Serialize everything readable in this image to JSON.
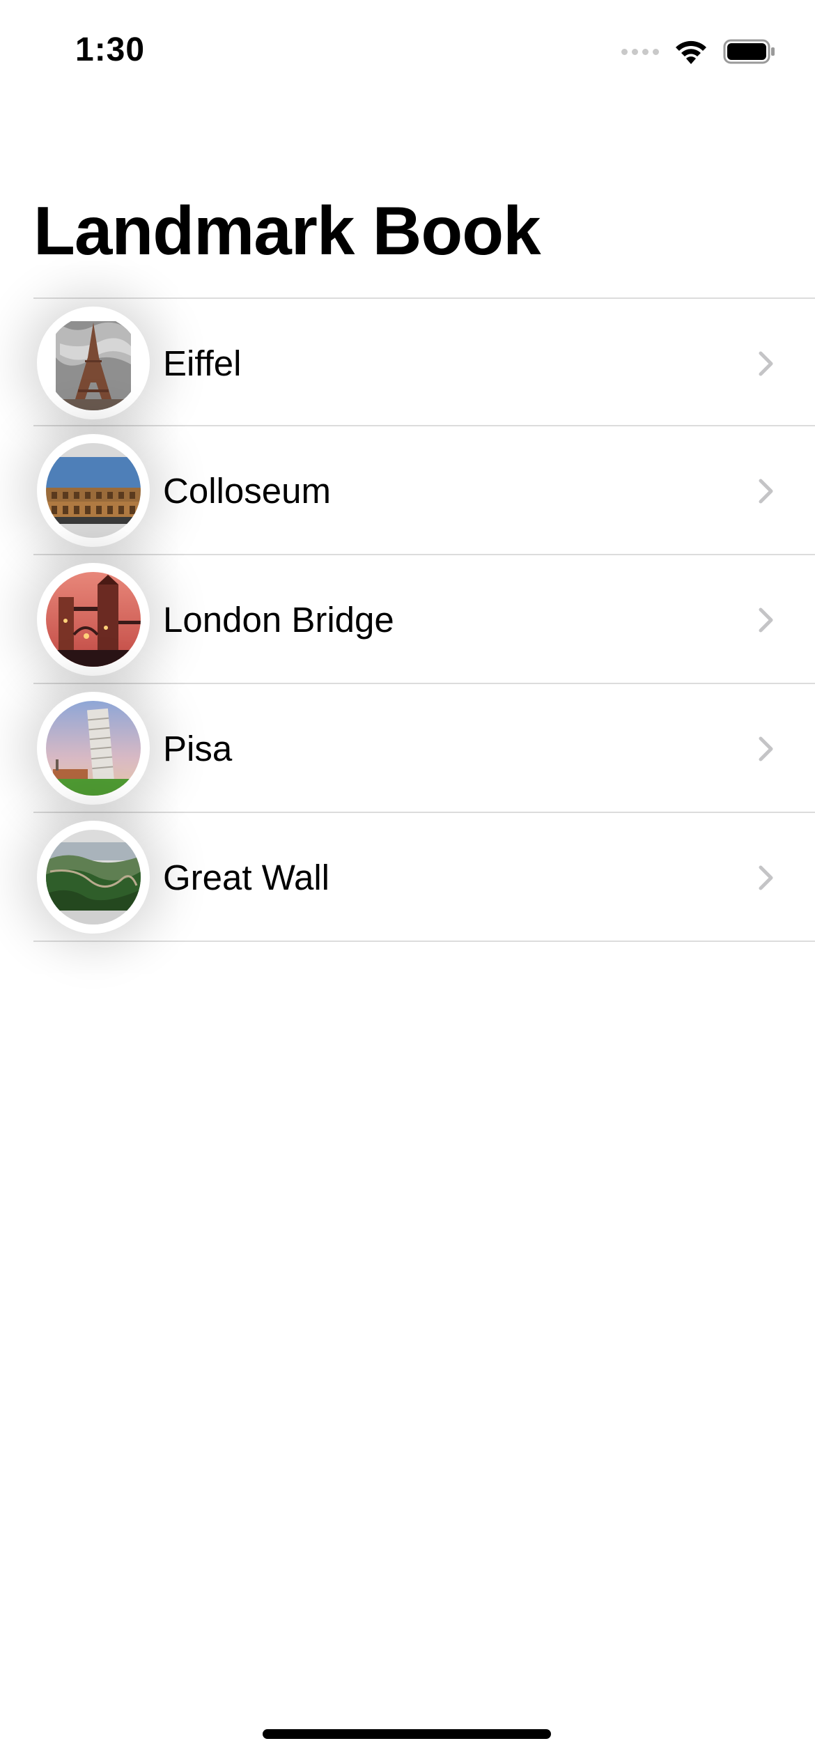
{
  "status_bar": {
    "time": "1:30",
    "icons": [
      "signal-icon",
      "wifi-icon",
      "battery-icon"
    ]
  },
  "navigation": {
    "title": "Landmark Book"
  },
  "landmarks": [
    {
      "name": "Eiffel",
      "thumbnail": "eiffel-tower-photo"
    },
    {
      "name": "Colloseum",
      "thumbnail": "colosseum-photo"
    },
    {
      "name": "London Bridge",
      "thumbnail": "tower-bridge-photo"
    },
    {
      "name": "Pisa",
      "thumbnail": "leaning-tower-pisa-photo"
    },
    {
      "name": "Great Wall",
      "thumbnail": "great-wall-photo"
    }
  ],
  "colors": {
    "background": "#ffffff",
    "separator": "#dcdcdc",
    "chevron": "#c4c4c6",
    "text": "#000000"
  }
}
